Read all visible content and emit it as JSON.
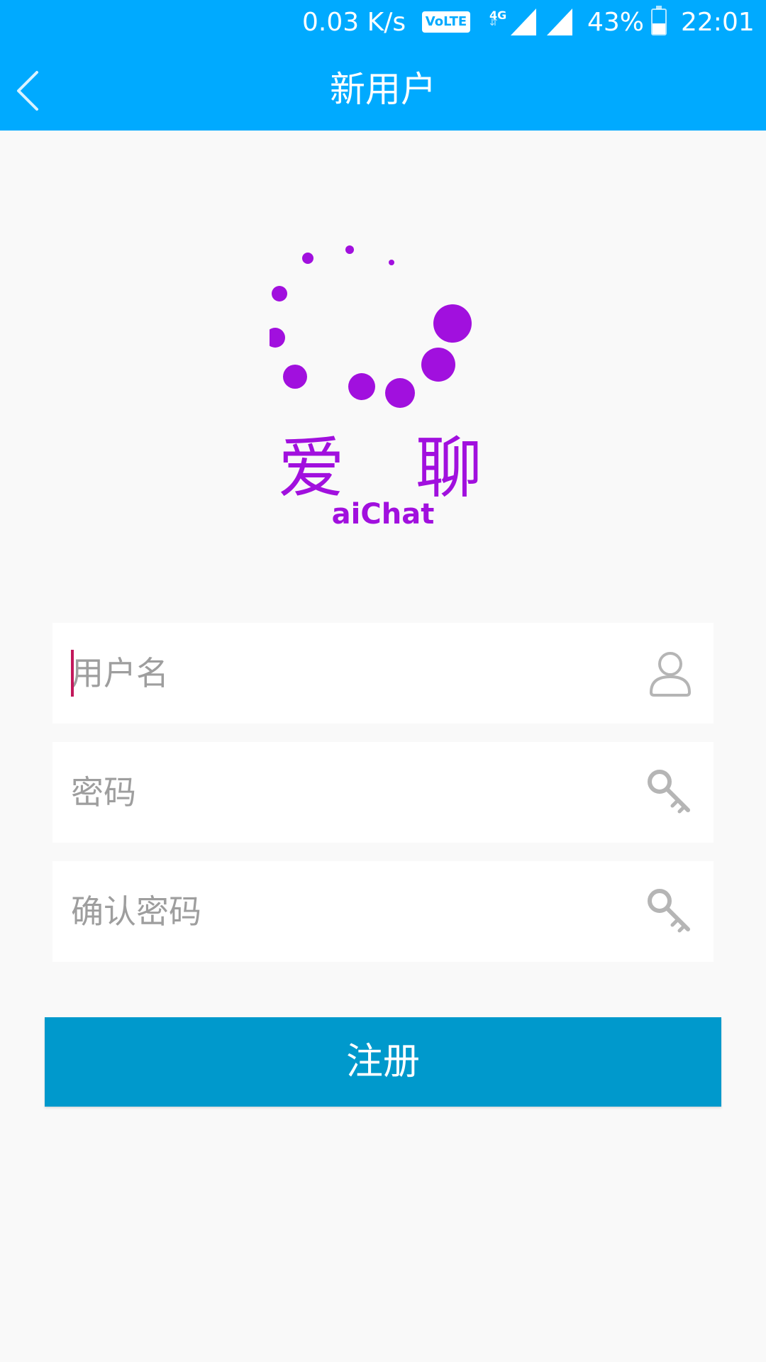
{
  "status_bar": {
    "net_speed": "0.03 K/s",
    "volte": "VoLTE",
    "network_type": "4G",
    "battery_percent": "43%",
    "battery_level": 0.43,
    "time": "22:01"
  },
  "app_bar": {
    "title": "新用户",
    "back_icon": "chevron-left-icon"
  },
  "logo": {
    "chinese_left": "爱",
    "chinese_right": "聊",
    "english": "aiChat",
    "color": "#a110de"
  },
  "form": {
    "username": {
      "placeholder": "用户名",
      "value": "",
      "icon": "user-icon"
    },
    "password": {
      "placeholder": "密码",
      "value": "",
      "icon": "key-icon"
    },
    "confirm_password": {
      "placeholder": "确认密码",
      "value": "",
      "icon": "key-icon"
    }
  },
  "register_button": {
    "label": "注册"
  },
  "colors": {
    "app_bar": "#00aaff",
    "button": "#0099cc",
    "background": "#f9f9f9",
    "cursor": "#c2185b"
  }
}
